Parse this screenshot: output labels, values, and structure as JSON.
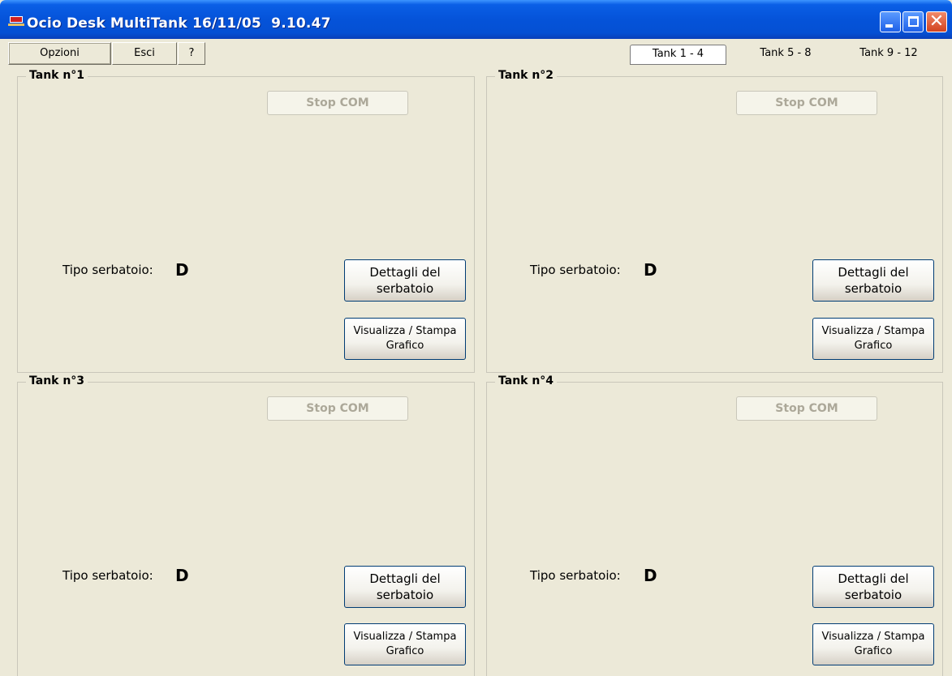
{
  "window": {
    "title": "Ocio Desk MultiTank 16/11/05  9.10.47",
    "close_glyph": "✕"
  },
  "menu": {
    "opzioni": "Opzioni",
    "esci": "Esci",
    "help": "?"
  },
  "tabs": [
    "Tank 1 - 4",
    "Tank 5 - 8",
    "Tank 9 - 12"
  ],
  "tanks": [
    {
      "title": "Tank n°1",
      "stop": "Stop COM",
      "tipo_label": "Tipo serbatoio:",
      "tipo_value": "D",
      "details_1": "Dettagli del",
      "details_2": "serbatoio",
      "graph_1": "Visualizza / Stampa",
      "graph_2": "Grafico"
    },
    {
      "title": "Tank n°2",
      "stop": "Stop COM",
      "tipo_label": "Tipo serbatoio:",
      "tipo_value": "D",
      "details_1": "Dettagli del",
      "details_2": "serbatoio",
      "graph_1": "Visualizza / Stampa",
      "graph_2": "Grafico"
    },
    {
      "title": "Tank n°3",
      "stop": "Stop COM",
      "tipo_label": "Tipo serbatoio:",
      "tipo_value": "D",
      "details_1": "Dettagli del",
      "details_2": "serbatoio",
      "graph_1": "Visualizza / Stampa",
      "graph_2": "Grafico"
    },
    {
      "title": "Tank n°4",
      "stop": "Stop COM",
      "tipo_label": "Tipo serbatoio:",
      "tipo_value": "D",
      "details_1": "Dettagli del",
      "details_2": "serbatoio",
      "graph_1": "Visualizza / Stampa",
      "graph_2": "Grafico"
    }
  ]
}
